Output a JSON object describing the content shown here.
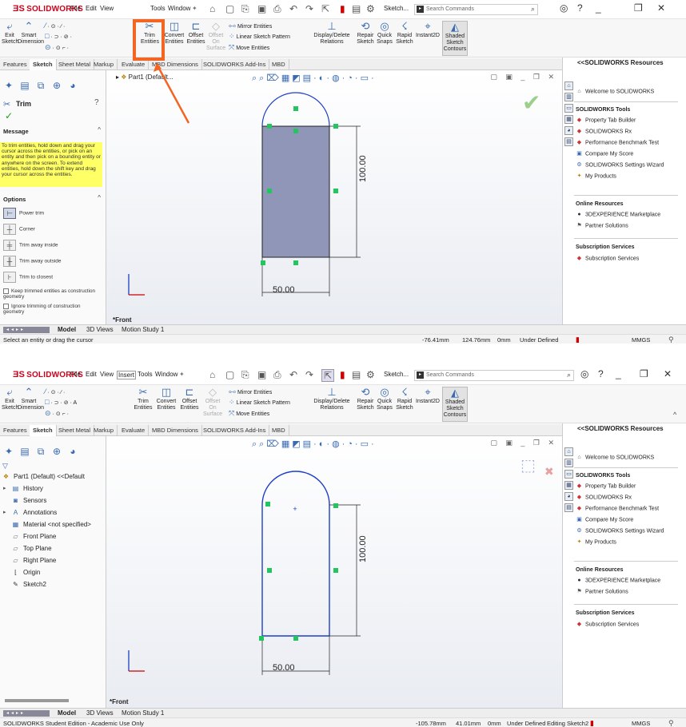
{
  "app": {
    "logo_brand": "SOLIDWORKS",
    "logo_symbol": "ƎS",
    "menus": [
      "File",
      "Edit",
      "View",
      "Insert",
      "Tools",
      "Window"
    ],
    "pin_icon": "pin-icon",
    "search": {
      "prefix": "Sketch...",
      "placeholder": "Search Commands"
    },
    "window_controls": {
      "minimize": "_",
      "restore": "❐",
      "close": "✕",
      "help": "?"
    }
  },
  "ribbon": {
    "exit_sketch": "Exit Sketch",
    "smart_dimension": "Smart Dimension",
    "trim_entities": "Trim Entities",
    "convert_entities": "Convert Entities",
    "offset_entities": "Offset Entities",
    "offset_on_surface": "Offset On Surface",
    "mirror_entities": "Mirror Entities",
    "linear_sketch_pattern": "Linear Sketch Pattern",
    "move_entities": "Move Entities",
    "display_delete_relations": "Display/Delete Relations",
    "repair_sketch": "Repair Sketch",
    "quick_snaps": "Quick Snaps",
    "rapid_sketch": "Rapid Sketch",
    "instant2d": "Instant2D",
    "shaded_sketch_contours": "Shaded Sketch Contours"
  },
  "tabs": [
    "Features",
    "Sketch",
    "Sheet Metal",
    "Markup",
    "Evaluate",
    "MBD Dimensions",
    "SOLIDWORKS Add-Ins",
    "MBD"
  ],
  "top": {
    "tree_root_short": "Part1 (Default...",
    "pm": {
      "title": "Trim",
      "message_header": "Message",
      "message": "To trim entities, hold down and drag your cursor across the entities, or pick on an entity and then pick on a bounding entity or anywhere on the screen. To extend entities, hold down the shift key and drag your cursor across the entities.",
      "options_header": "Options",
      "options": [
        "Power trim",
        "Corner",
        "Trim away inside",
        "Trim away outside",
        "Trim to closest"
      ],
      "checks": [
        "Keep trimmed entities as construction geometry",
        "Ignore trimming of construction geometry"
      ]
    },
    "dimension_vertical": "100.00",
    "dimension_horizontal": "50.00",
    "view_label": "*Front",
    "status": {
      "left": "Select an entity or drag the cursor",
      "x": "-76.41mm",
      "y": "124.76mm",
      "z": "0mm",
      "state": "Under Defined",
      "units": "MMGS"
    }
  },
  "bottom": {
    "tree": [
      {
        "label": "Part1 (Default) <<Default",
        "icon": "part-icon"
      },
      {
        "label": "History",
        "icon": "history-icon"
      },
      {
        "label": "Sensors",
        "icon": "sensors-icon"
      },
      {
        "label": "Annotations",
        "icon": "annotations-icon"
      },
      {
        "label": "Material <not specified>",
        "icon": "material-icon"
      },
      {
        "label": "Front Plane",
        "icon": "plane-icon"
      },
      {
        "label": "Top Plane",
        "icon": "plane-icon"
      },
      {
        "label": "Right Plane",
        "icon": "plane-icon"
      },
      {
        "label": "Origin",
        "icon": "origin-icon"
      },
      {
        "label": "Sketch2",
        "icon": "sketch-icon"
      }
    ],
    "dimension_vertical": "100.00",
    "dimension_horizontal": "50.00",
    "view_label": "*Front",
    "status": {
      "left": "SOLIDWORKS Student Edition - Academic Use Only",
      "x": "-105.78mm",
      "y": "41.01mm",
      "z": "0mm",
      "state": "Under Defined",
      "editing": "Editing Sketch2",
      "units": "MMGS"
    }
  },
  "bottom_tabs": [
    "Model",
    "3D Views",
    "Motion Study 1"
  ],
  "resources": {
    "title": "<<SOLIDWORKS Resources",
    "welcome": "Welcome to SOLIDWORKS",
    "tools_header": "SOLIDWORKS Tools",
    "tools": [
      "Property Tab Builder",
      "SOLIDWORKS Rx",
      "Performance Benchmark Test",
      "Compare My Score",
      "SOLIDWORKS Settings Wizard",
      "My Products"
    ],
    "online_header": "Online Resources",
    "online": [
      "3DEXPERIENCE Marketplace",
      "Partner Solutions"
    ],
    "subscription_header": "Subscription Services",
    "subscription": [
      "Subscription Services"
    ]
  },
  "colors": {
    "highlight": "#f26522",
    "sketch_blue": "#1f3fc4",
    "relation_green": "#22c55e",
    "message_yellow": "#ffff66"
  }
}
